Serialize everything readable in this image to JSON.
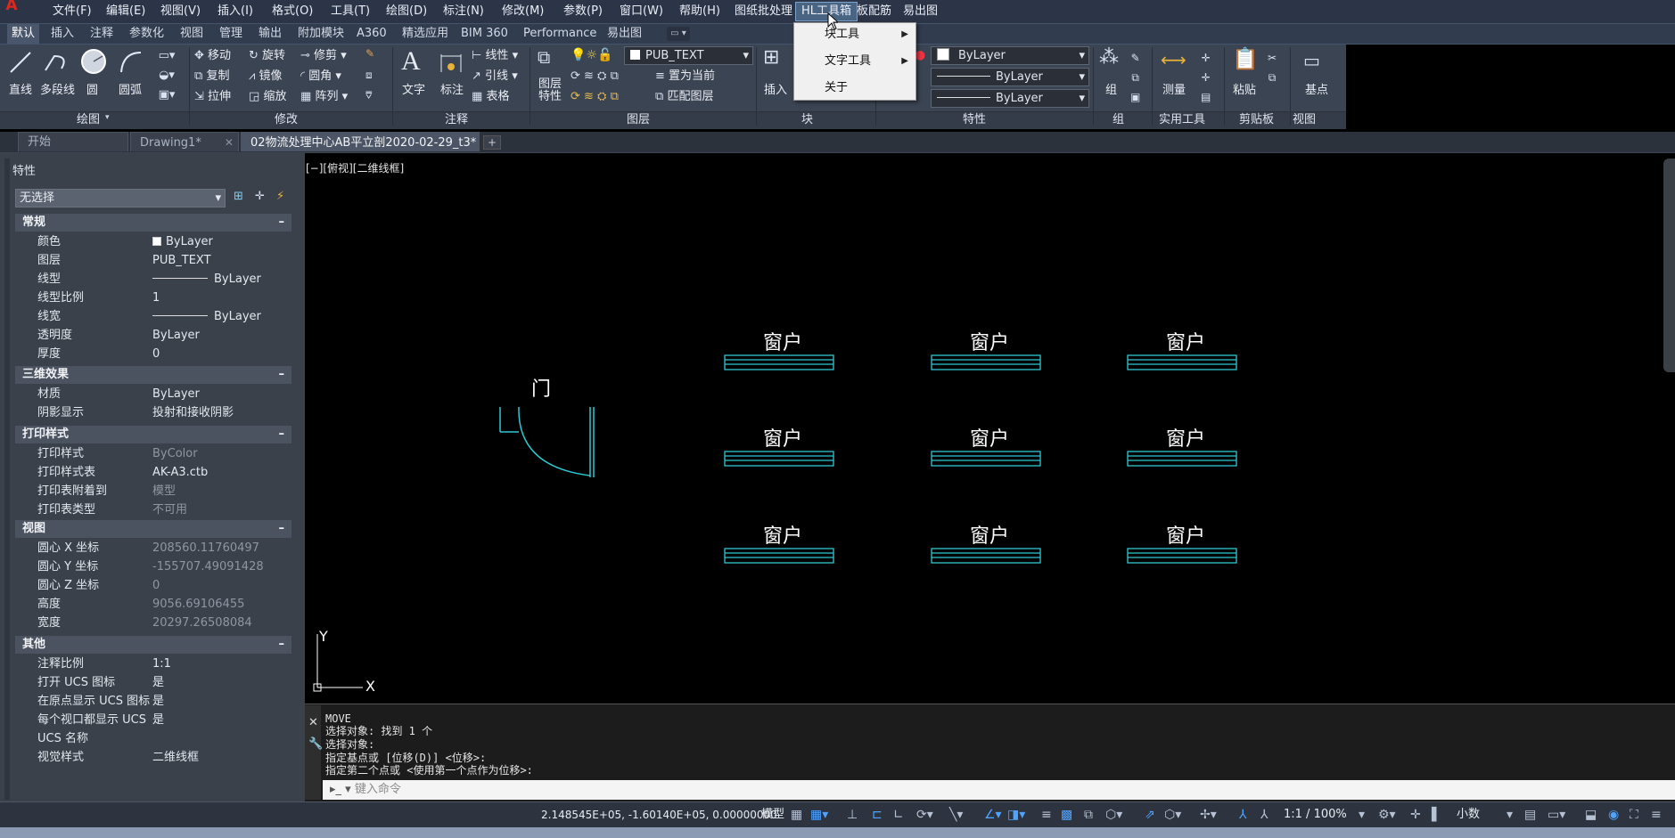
{
  "menubar": {
    "items": [
      "文件(F)",
      "编辑(E)",
      "视图(V)",
      "插入(I)",
      "格式(O)",
      "工具(T)",
      "绘图(D)",
      "标注(N)",
      "修改(M)",
      "参数(P)",
      "窗口(W)",
      "帮助(H)",
      "图纸批处理",
      "HL工具箱",
      "板配筋",
      "易出图"
    ]
  },
  "hl_menu": {
    "items": [
      "块工具",
      "文字工具",
      "关于"
    ]
  },
  "ribbon": {
    "tabs": [
      "默认",
      "插入",
      "注释",
      "参数化",
      "视图",
      "管理",
      "输出",
      "附加模块",
      "A360",
      "精选应用",
      "BIM 360",
      "Performance",
      "易出图"
    ],
    "draw": {
      "line": "直线",
      "polyline": "多段线",
      "circle": "圆",
      "arc": "圆弧",
      "title": "绘图"
    },
    "modify": {
      "move": "移动",
      "rotate": "旋转",
      "trim": "修剪",
      "copy": "复制",
      "mirror": "镜像",
      "fillet": "圆角",
      "stretch": "拉伸",
      "scale": "缩放",
      "array": "阵列",
      "title": "修改"
    },
    "annotation": {
      "text": "文字",
      "dimension": "标注",
      "linear": "线性",
      "leader": "引线",
      "table": "表格",
      "title": "注释"
    },
    "layers": {
      "layer_props": "图层\n特性",
      "layer_name": "PUB_TEXT",
      "set_current": "置为当前",
      "match": "匹配图层",
      "title": "图层"
    },
    "block": {
      "insert": "插入",
      "title": "块"
    },
    "properties": {
      "color": "ByLayer",
      "linetype": "ByLayer",
      "lineweight": "ByLayer",
      "title": "特性"
    },
    "groups": {
      "group": "组",
      "title": "组"
    },
    "utilities": {
      "measure": "测量",
      "title": "实用工具"
    },
    "clipboard": {
      "paste": "粘贴",
      "title": "剪贴板"
    },
    "view": {
      "base": "基点",
      "title": "视图"
    }
  },
  "doc_tabs": [
    "开始",
    "Drawing1*",
    "02物流处理中心AB平立剖2020-02-29_t3*"
  ],
  "properties_panel": {
    "title": "特性",
    "selection": "无选择",
    "sections": [
      {
        "title": "常规",
        "rows": [
          [
            "颜色",
            "ByLayer"
          ],
          [
            "图层",
            "PUB_TEXT"
          ],
          [
            "线型",
            "ByLayer"
          ],
          [
            "线型比例",
            "1"
          ],
          [
            "线宽",
            "ByLayer"
          ],
          [
            "透明度",
            "ByLayer"
          ],
          [
            "厚度",
            "0"
          ]
        ]
      },
      {
        "title": "三维效果",
        "rows": [
          [
            "材质",
            "ByLayer"
          ],
          [
            "阴影显示",
            "投射和接收阴影"
          ]
        ]
      },
      {
        "title": "打印样式",
        "rows": [
          [
            "打印样式",
            "ByColor"
          ],
          [
            "打印样式表",
            "AK-A3.ctb"
          ],
          [
            "打印表附着到",
            "模型"
          ],
          [
            "打印表类型",
            "不可用"
          ]
        ]
      },
      {
        "title": "视图",
        "rows": [
          [
            "圆心 X 坐标",
            "208560.11760497"
          ],
          [
            "圆心 Y 坐标",
            "-155707.49091428"
          ],
          [
            "圆心 Z 坐标",
            "0"
          ],
          [
            "高度",
            "9056.69106455"
          ],
          [
            "宽度",
            "20297.26508084"
          ]
        ]
      },
      {
        "title": "其他",
        "rows": [
          [
            "注释比例",
            "1:1"
          ],
          [
            "打开 UCS 图标",
            "是"
          ],
          [
            "在原点显示 UCS 图标",
            "是"
          ],
          [
            "每个视口都显示 UCS",
            "是"
          ],
          [
            "UCS 名称",
            ""
          ],
          [
            "视觉样式",
            "二维线框"
          ]
        ]
      }
    ]
  },
  "canvas": {
    "viewport_label": "[−][俯视][二维线框]",
    "window_label": "窗户",
    "door_label": "门",
    "ucs_x": "X",
    "ucs_y": "Y"
  },
  "command": {
    "lines": [
      "MOVE",
      "选择对象: 找到 1 个",
      "选择对象:",
      "指定基点或 [位移(D)] <位移>:",
      "指定第二个点或 <使用第一个点作为位移>:"
    ],
    "placeholder": "键入命令"
  },
  "status": {
    "coords": "2.148545E+05, -1.60140E+05, 0.00000000",
    "model": "模型",
    "scale": "1:1 / 100%",
    "units": "小数"
  },
  "colors": {
    "drawing_cyan": "#2ec8d2",
    "drawing_white": "#ffffff",
    "menubar": "#2b3547",
    "ribbon": "#3b4453"
  }
}
